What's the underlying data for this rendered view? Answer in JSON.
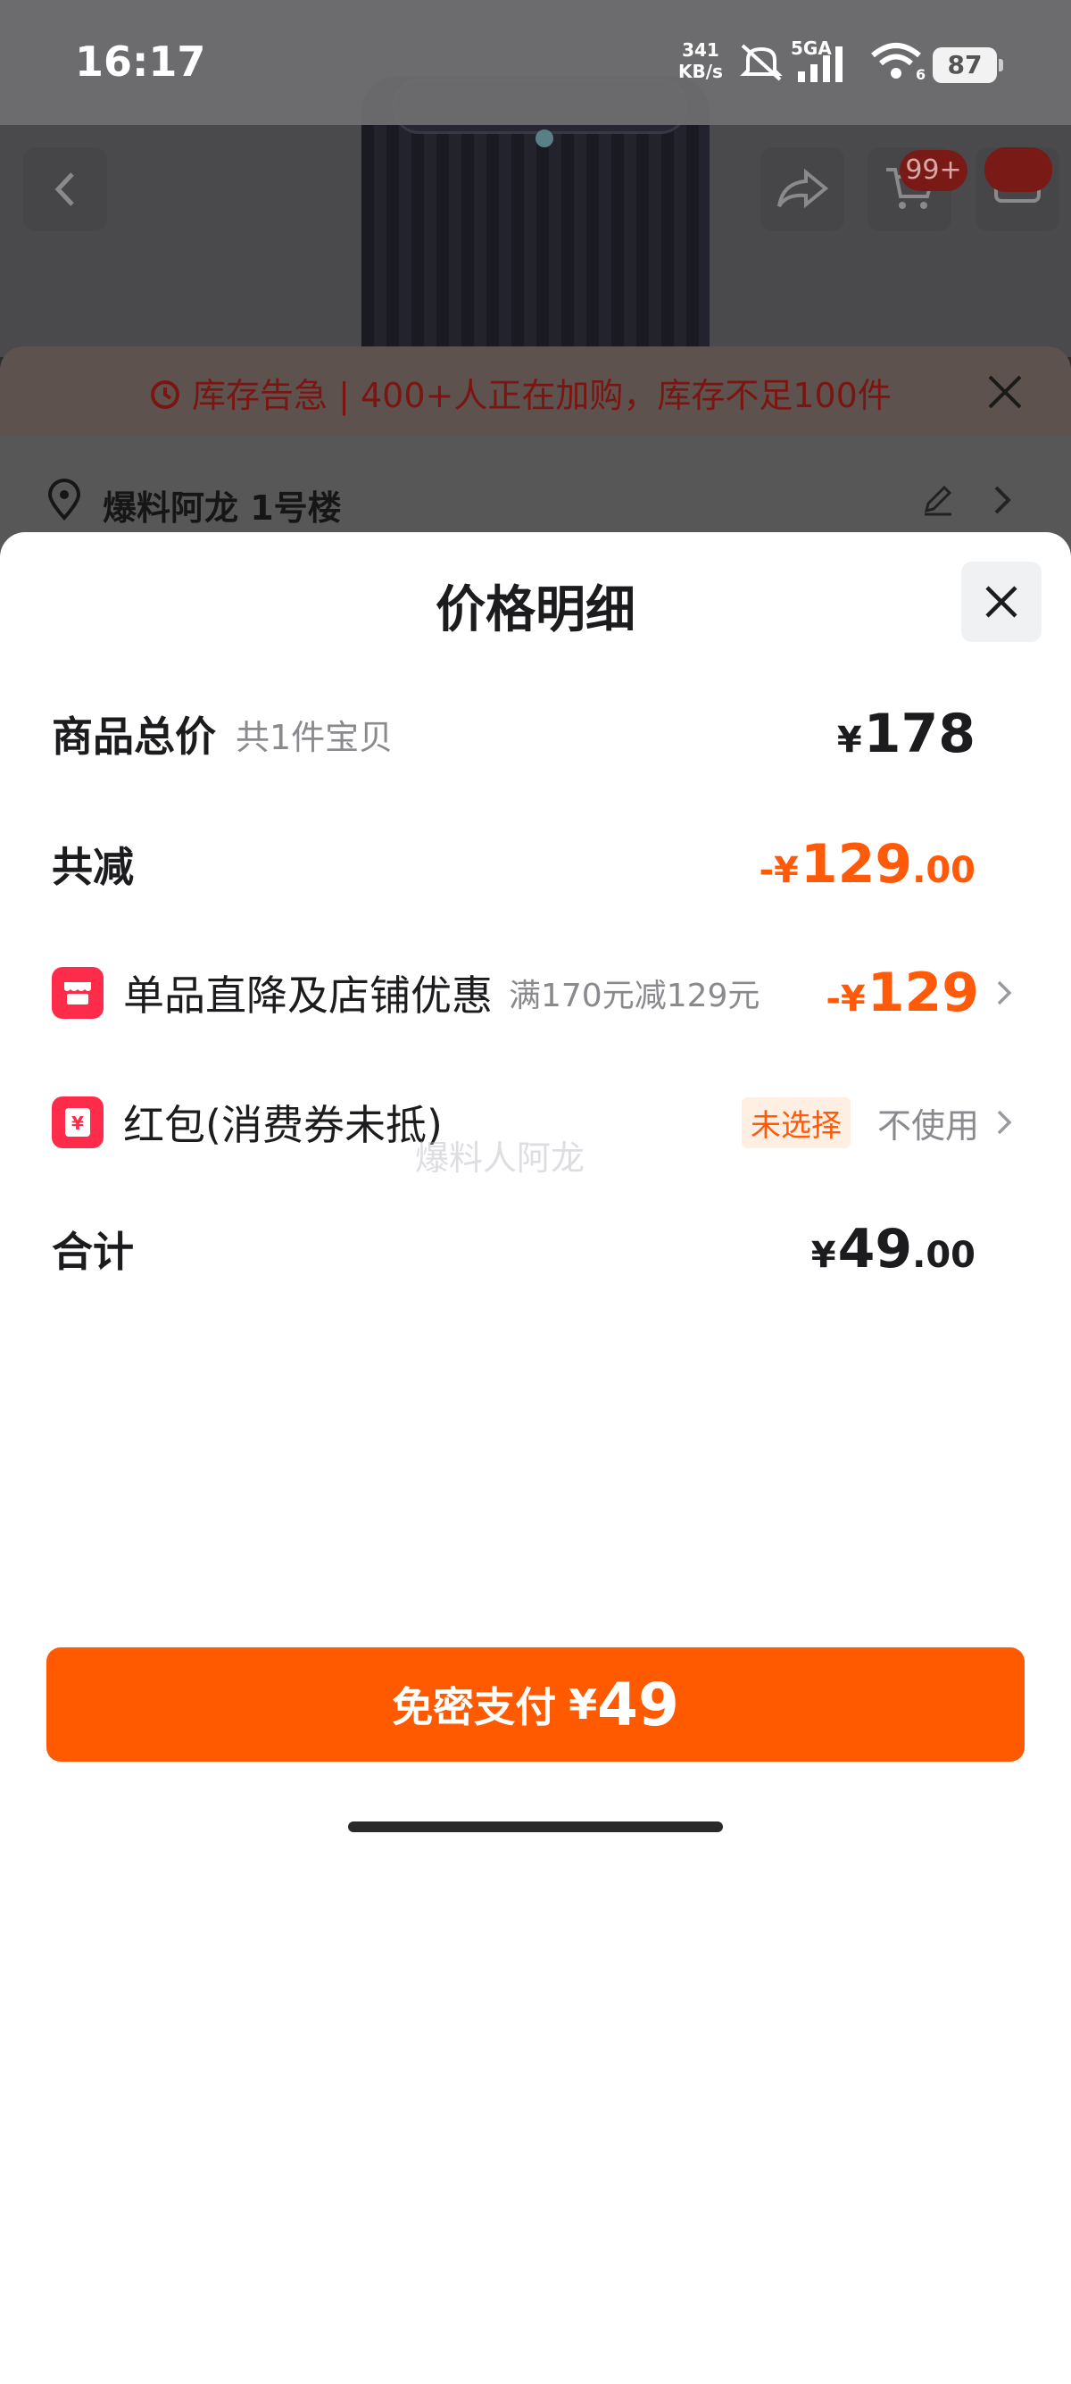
{
  "status_bar": {
    "time": "16:17",
    "net_speed_value": "341",
    "net_speed_unit": "KB/s",
    "network": "5GA",
    "wifi_sub": "6",
    "battery": "87"
  },
  "background": {
    "cart_badge": "99+",
    "alert_text": "库存告急 | 400+人正在加购，库存不足100件",
    "address": "爆料阿龙 1号楼"
  },
  "sheet": {
    "title": "价格明细",
    "rows": {
      "total": {
        "label": "商品总价",
        "sub": "共1件宝贝",
        "currency": "¥",
        "value": "178"
      },
      "reduce": {
        "label": "共减",
        "prefix": "-¥",
        "value": "129",
        "decimals": ".00"
      },
      "discount": {
        "label": "单品直降及店铺优惠",
        "sub": "满170元减129元",
        "prefix": "-¥",
        "value": "129"
      },
      "redpacket": {
        "label": "红包(消费券未抵)",
        "tag": "未选择",
        "action": "不使用"
      },
      "sum": {
        "label": "合计",
        "currency": "¥",
        "value": "49",
        "decimals": ".00"
      }
    },
    "watermark": "爆料人阿龙"
  },
  "pay_button": {
    "label": "免密支付",
    "currency": "¥",
    "amount": "49"
  },
  "colors": {
    "accent": "#ff5a00",
    "discount": "#ff5a0a",
    "icon_red": "#ff2b4a"
  }
}
